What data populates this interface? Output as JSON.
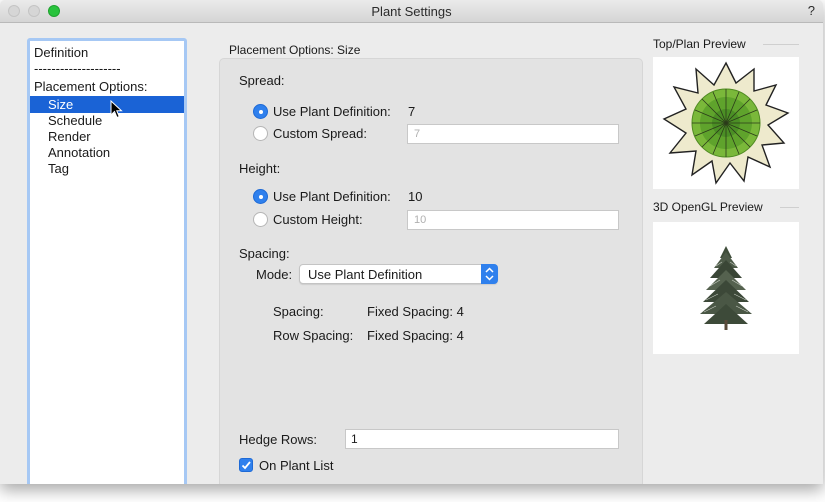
{
  "window": {
    "title": "Plant Settings",
    "help": "?"
  },
  "sidebar": {
    "items": [
      {
        "label": "Definition",
        "selected": false
      },
      {
        "label": "--------------------",
        "selected": false
      },
      {
        "label": "Placement Options:",
        "selected": false
      },
      {
        "label": "Size",
        "selected": true
      },
      {
        "label": "Schedule",
        "selected": false
      },
      {
        "label": "Render",
        "selected": false
      },
      {
        "label": "Annotation",
        "selected": false
      },
      {
        "label": "Tag",
        "selected": false
      }
    ]
  },
  "main": {
    "section_title": "Placement Options: Size",
    "spread": {
      "heading": "Spread:",
      "use_def_label": "Use Plant Definition:",
      "use_def_value": "7",
      "custom_label": "Custom Spread:",
      "custom_value": "7",
      "selected": "use_definition"
    },
    "height": {
      "heading": "Height:",
      "use_def_label": "Use Plant Definition:",
      "use_def_value": "10",
      "custom_label": "Custom Height:",
      "custom_value": "10",
      "selected": "use_definition"
    },
    "spacing": {
      "heading": "Spacing:",
      "mode_label": "Mode:",
      "mode_value": "Use Plant Definition",
      "spacing_label": "Spacing:",
      "spacing_value": "Fixed Spacing: 4",
      "row_spacing_label": "Row Spacing:",
      "row_spacing_value": "Fixed Spacing: 4"
    },
    "hedge_rows": {
      "label": "Hedge Rows:",
      "value": "1"
    },
    "on_plant_list": {
      "label": "On Plant List",
      "checked": true
    }
  },
  "previews": {
    "top_plan_label": "Top/Plan Preview",
    "opengl_label": "3D OpenGL Preview"
  },
  "colors": {
    "accent": "#2f80ed",
    "selection": "#1a63d6",
    "focus_ring": "#a6c8f4",
    "traffic_green": "#29c33d"
  }
}
